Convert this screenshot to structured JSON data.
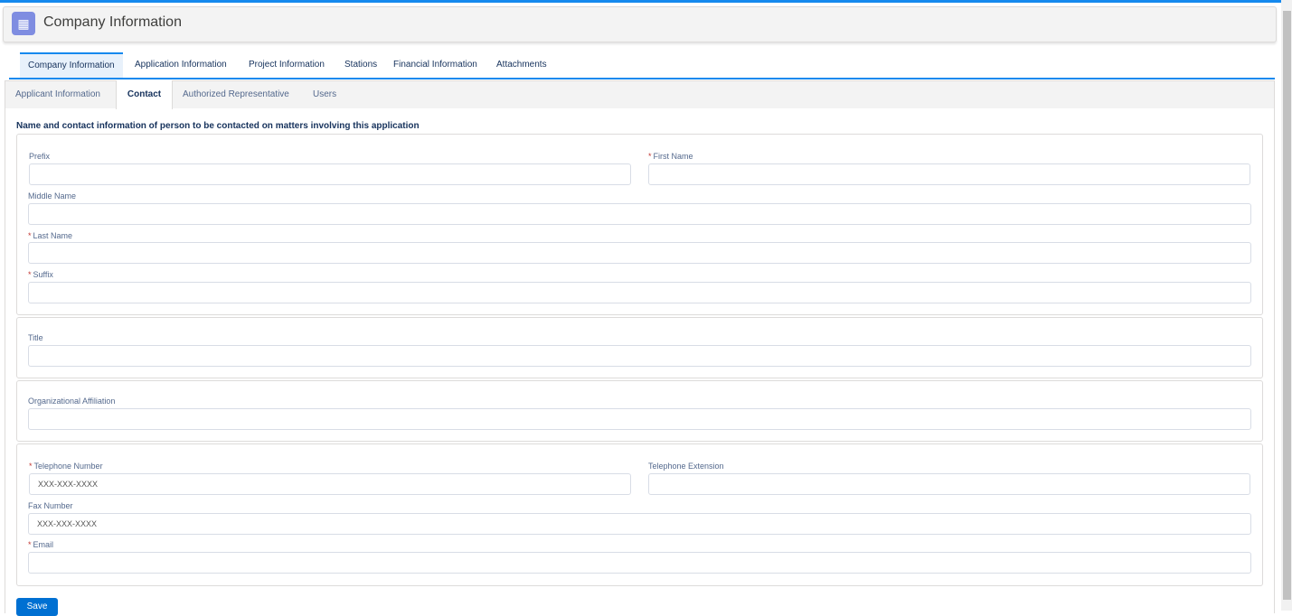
{
  "header": {
    "title": "Company Information",
    "icon": "building-icon"
  },
  "top_tabs": [
    "Company Information",
    "Application Information",
    "Project Information",
    "Stations",
    "Financial Information",
    "Attachments"
  ],
  "sub_tabs": [
    "Applicant Information",
    "Contact",
    "Authorized Representative",
    "Users"
  ],
  "section_heading": "Name and contact information of person to be contacted on matters involving this application",
  "fields": {
    "prefix": {
      "label": "Prefix",
      "value": ""
    },
    "first_name": {
      "label": "First Name",
      "value": ""
    },
    "middle_name": {
      "label": "Middle Name",
      "value": ""
    },
    "last_name": {
      "label": "Last Name",
      "value": ""
    },
    "suffix": {
      "label": "Suffix",
      "value": ""
    },
    "title": {
      "label": "Title",
      "value": ""
    },
    "org": {
      "label": "Organizational Affiliation",
      "value": ""
    },
    "telephone": {
      "label": "Telephone Number",
      "placeholder": "XXX-XXX-XXXX"
    },
    "extension": {
      "label": "Telephone Extension",
      "value": ""
    },
    "fax": {
      "label": "Fax Number",
      "placeholder": "XXX-XXX-XXXX"
    },
    "email": {
      "label": "Email",
      "value": ""
    }
  },
  "required_marker": "*",
  "save_label": "Save",
  "colors": {
    "accent": "#1589ee",
    "button": "#0070d2",
    "icon": "#7f8de1",
    "required": "#c23934"
  }
}
